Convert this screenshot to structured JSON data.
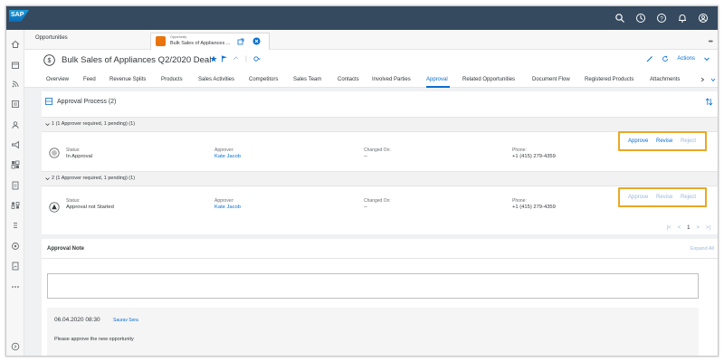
{
  "shell": {
    "logo": "SAP",
    "icons": [
      "search-icon",
      "history-icon",
      "help-icon",
      "notifications-icon",
      "user-icon"
    ]
  },
  "tabs": {
    "opportunities": "Opportunities",
    "active_sub": "Opportunity",
    "active_title": "Bulk Sales of Appliances ..."
  },
  "header": {
    "title": "Bulk Sales of Appliances Q2/2020 Deal",
    "actions": "Actions"
  },
  "section_tabs": [
    "Overview",
    "Feed",
    "Revenue Splits",
    "Products",
    "Sales Activities",
    "Competitors",
    "Sales Team",
    "Contacts",
    "Involved Parties",
    "Approval",
    "Related Opportunities",
    "Document Flow",
    "Registered Products",
    "Attachments"
  ],
  "approval": {
    "title": "Approval Process",
    "count": "(2)",
    "groups": [
      {
        "label": "1 (1 Approver required, 1 pending) (1)",
        "status_label": "Status:",
        "status": "In Approval",
        "approver_label": "Approver:",
        "approver": "Kate Jacob",
        "changed_label": "Changed On:",
        "changed": "--",
        "phone_label": "Phone:",
        "phone": "+1 (415) 279-4359",
        "buttons": [
          "Approve",
          "Revise",
          "Reject"
        ]
      },
      {
        "label": "2 (1 Approver required, 1 pending) (1)",
        "status_label": "Status:",
        "status": "Approval not Started",
        "approver_label": "Approver:",
        "approver": "Kate Jacob",
        "changed_label": "Changed On:",
        "changed": "--",
        "phone_label": "Phone:",
        "phone": "+1 (415) 279-4359",
        "buttons": [
          "Approve",
          "Revise",
          "Reject"
        ]
      }
    ],
    "pager": {
      "first": "|<",
      "prev": "<",
      "page": "1",
      "next": ">",
      "last": ">|"
    }
  },
  "note": {
    "title": "Approval Note",
    "expand_all": "Expand All",
    "date": "06.04.2020 08:30",
    "author": "Saurav Sera",
    "text": "Please approve the new opportunity"
  },
  "colors": {
    "shell": "#354a5f",
    "accent": "#0a6ed1",
    "highlight_border": "#e9a825",
    "object_icon": "#e9730c"
  }
}
